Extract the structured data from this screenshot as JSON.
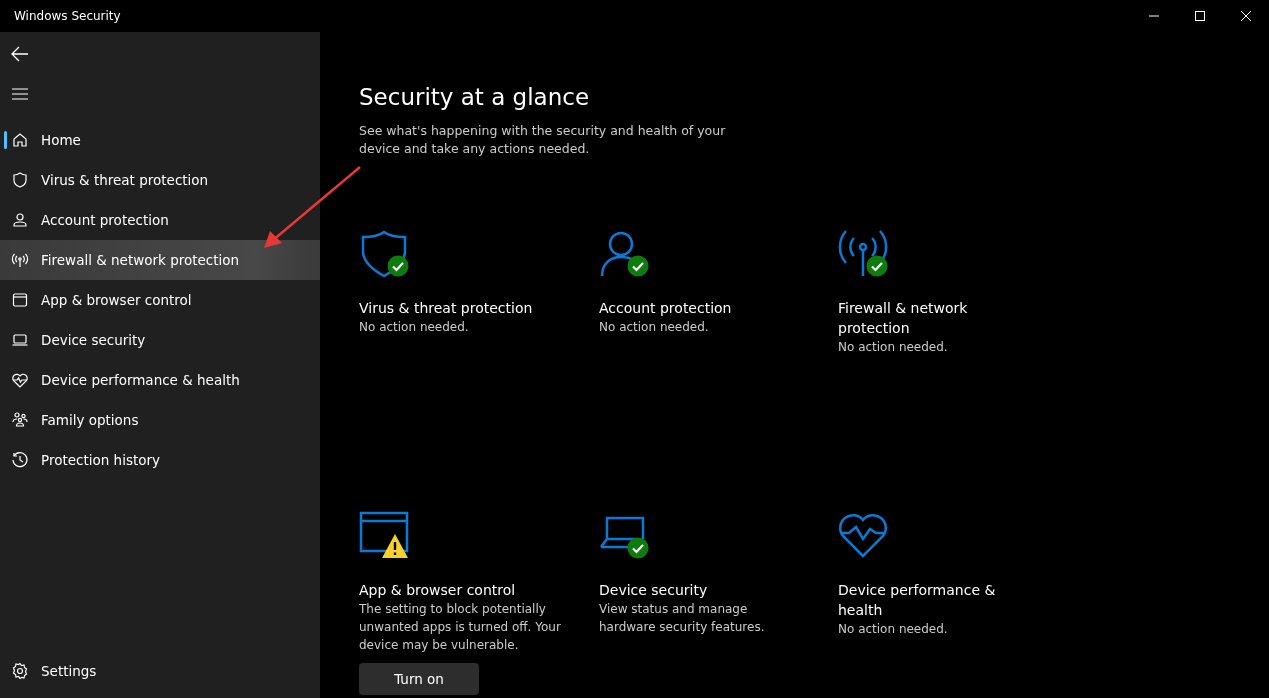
{
  "window": {
    "title": "Windows Security"
  },
  "sidebar": {
    "items": [
      {
        "label": "Home",
        "kind": "home",
        "selected": true,
        "highlighted": false
      },
      {
        "label": "Virus & threat protection",
        "kind": "shield",
        "selected": false,
        "highlighted": false
      },
      {
        "label": "Account protection",
        "kind": "person",
        "selected": false,
        "highlighted": false
      },
      {
        "label": "Firewall & network protection",
        "kind": "antenna",
        "selected": false,
        "highlighted": true
      },
      {
        "label": "App & browser control",
        "kind": "window",
        "selected": false,
        "highlighted": false
      },
      {
        "label": "Device security",
        "kind": "laptop",
        "selected": false,
        "highlighted": false
      },
      {
        "label": "Device performance & health",
        "kind": "heart",
        "selected": false,
        "highlighted": false
      },
      {
        "label": "Family options",
        "kind": "family",
        "selected": false,
        "highlighted": false
      },
      {
        "label": "Protection history",
        "kind": "history",
        "selected": false,
        "highlighted": false
      }
    ],
    "settings": "Settings"
  },
  "main": {
    "title": "Security at a glance",
    "subtitle": "See what's happening with the security and health of your device and take any actions needed.",
    "cards": [
      {
        "kind": "shield",
        "checked": true,
        "warning": false,
        "title": "Virus & threat protection",
        "description": "No action needed."
      },
      {
        "kind": "person",
        "checked": true,
        "warning": false,
        "title": "Account protection",
        "description": "No action needed."
      },
      {
        "kind": "antenna",
        "checked": true,
        "warning": false,
        "title": "Firewall & network protection",
        "description": "No action needed."
      },
      {
        "kind": "window",
        "checked": false,
        "warning": true,
        "title": "App & browser control",
        "description": "The setting to block potentially unwanted apps is turned off. Your device may be vulnerable.",
        "button": "Turn on"
      },
      {
        "kind": "laptop",
        "checked": true,
        "warning": false,
        "title": "Device security",
        "description": "View status and manage hardware security features."
      },
      {
        "kind": "heart",
        "checked": false,
        "warning": false,
        "title": "Device performance & health",
        "description": "No action needed."
      }
    ]
  }
}
